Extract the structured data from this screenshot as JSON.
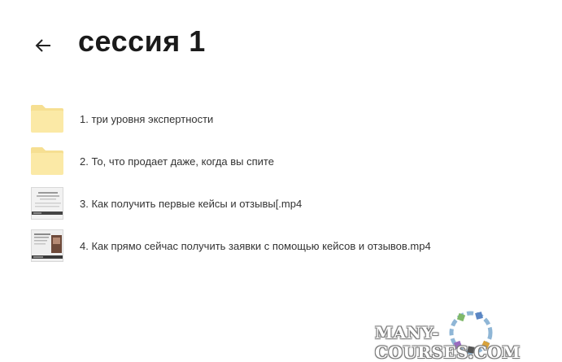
{
  "header": {
    "back_icon": "arrow-left-icon",
    "title": "сессия 1"
  },
  "items": [
    {
      "label": "1. три уровня экспертности",
      "type": "folder",
      "icon": "folder-icon"
    },
    {
      "label": "2. То, что продает даже, когда вы спите",
      "type": "folder",
      "icon": "folder-icon"
    },
    {
      "label": "3. Как получить первые кейсы и отзывы[.mp4",
      "type": "video",
      "icon": "video-thumbnail"
    },
    {
      "label": "4. Как прямо сейчас получить заявки с помощью кейсов и отзывов.mp4",
      "type": "video",
      "icon": "video-thumbnail"
    }
  ],
  "watermark": {
    "text": "MANY-COURSES.COM"
  },
  "colors": {
    "folder": "#fbe9a6",
    "folder_tab": "#f6df92",
    "title": "#1a1a1a"
  }
}
